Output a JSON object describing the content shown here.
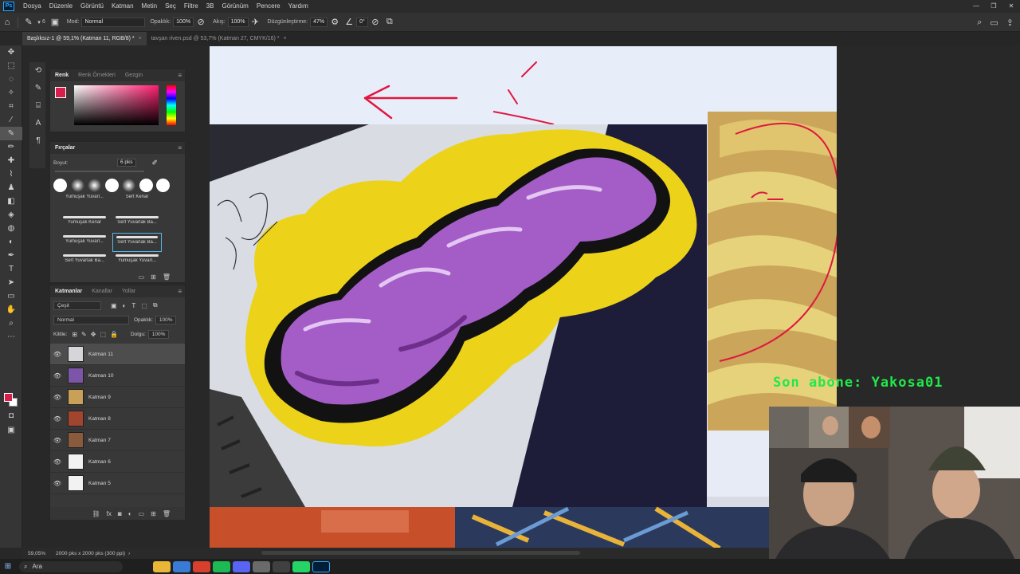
{
  "app": {
    "menu": [
      "Dosya",
      "Düzenle",
      "Görüntü",
      "Katman",
      "Metin",
      "Seç",
      "Filtre",
      "3B",
      "Görünüm",
      "Pencere",
      "Yardım"
    ],
    "logo": "Ps"
  },
  "options": {
    "mode_label": "Mod:",
    "mode_value": "Normal",
    "opacity_label": "Opaklık:",
    "opacity_value": "100%",
    "flow_label": "Akış:",
    "flow_value": "100%",
    "smoothing_label": "Düzgünleştirme:",
    "smoothing_value": "47%",
    "angle_value": "0°",
    "brush_size": "6"
  },
  "tabs": [
    {
      "label": "Başlıksız-1 @ 59,1% (Katman 11, RGB/8) *",
      "close": "×"
    },
    {
      "label": "tavşan riven.psd @ 53,7% (Katman 27, CMYK/16) *",
      "close": "×"
    }
  ],
  "color_panel": {
    "tabs": [
      "Renk",
      "Renk Örnekleri",
      "Gezgin"
    ],
    "foreground": "#d61f4b",
    "background": "#ffffff"
  },
  "brush_panel": {
    "title": "Fırçalar",
    "size_label": "Boyut:",
    "size_value": "6 pks",
    "presets": [
      "Yumuşak Yuvarl...",
      "Sert Kenar",
      "Yumuşak Kenar",
      "Sert Yuvarlak Ba...",
      "Yumuşak Yuvarl...",
      "Sert Yuvarlak Ba...",
      "Sert Yuvarlak Ba...",
      "Yumuşak Yuvarl..."
    ]
  },
  "layers_panel": {
    "tabs": [
      "Katmanlar",
      "Kanallar",
      "Yollar"
    ],
    "filter_label": "Çeşit",
    "blend_mode": "Normal",
    "opacity_label": "Opaklık:",
    "opacity_value": "100%",
    "lock_label": "Kilitle:",
    "fill_label": "Dolgu:",
    "fill_value": "100%",
    "layers": [
      "Katman 11",
      "Katman 10",
      "Katman 9",
      "Katman 8",
      "Katman 7",
      "Katman 6",
      "Katman 5"
    ],
    "selected_index": 0
  },
  "status": {
    "zoom": "59,05%",
    "doc_size": "2000 pks x 2000 pks (300 ppi)"
  },
  "taskbar": {
    "search_placeholder": "Ara"
  },
  "overlay": {
    "subscriber_text": "Son abone: Yakosa01"
  }
}
